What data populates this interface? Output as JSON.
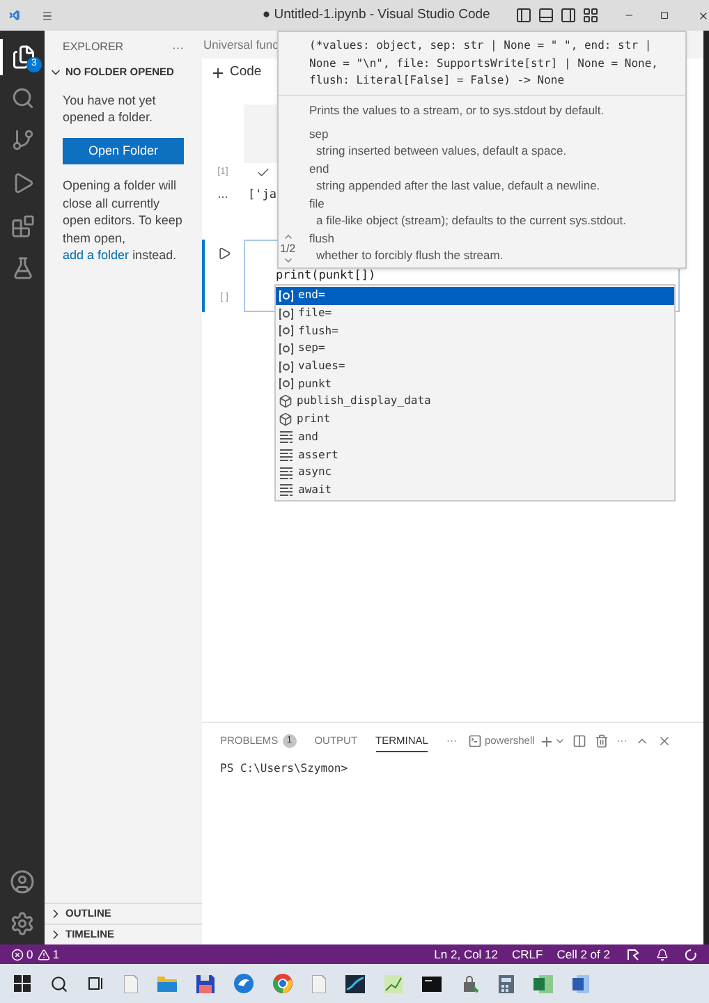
{
  "window": {
    "title": "● Untitled-1.ipynb - Visual Studio Code"
  },
  "activity_bar": {
    "explorer_badge": "3"
  },
  "sidebar": {
    "title": "EXPLORER",
    "more": "···",
    "section": {
      "label": "NO FOLDER OPENED",
      "expanded": true
    },
    "message": "You have not yet opened a folder.",
    "button": "Open Folder",
    "note": "Opening a folder will close all currently open editors. To keep them open,",
    "note_link": "add a folder",
    "note_end": "instead.",
    "bottom_sections": [
      {
        "label": "OUTLINE",
        "expanded": false
      },
      {
        "label": "TIMELINE",
        "expanded": false
      }
    ]
  },
  "editor": {
    "breadcrumb": "Universal func",
    "toolbar": {
      "add_code": "Code"
    },
    "cells": [
      {
        "exec_label": "[1]",
        "done": true,
        "output_dots": "...",
        "output": "['ja",
        "active": false
      },
      {
        "exec_label": "[ ]",
        "active": true,
        "code": "print(punkt[])"
      }
    ]
  },
  "hover": {
    "signature": [
      "(*values: object, sep: str | None = \" \", end: str |",
      "None = \"\\n\", file: SupportsWrite[str] | None = None,",
      "flush: Literal[False] = False) -> None"
    ],
    "description": "Prints the values to a stream, or to sys.stdout by default.",
    "params": [
      {
        "name": "sep",
        "desc": "string inserted between values, default a space."
      },
      {
        "name": "end",
        "desc": "string appended after the last value, default a newline."
      },
      {
        "name": "file",
        "desc": "a file-like object (stream); defaults to the current sys.stdout."
      },
      {
        "name": "flush",
        "desc": "whether to forcibly flush the stream."
      }
    ],
    "overload": "1/2"
  },
  "suggestions": [
    {
      "label": "end=",
      "kind": "variable",
      "selected": true
    },
    {
      "label": "file=",
      "kind": "variable",
      "selected": false
    },
    {
      "label": "flush=",
      "kind": "variable",
      "selected": false
    },
    {
      "label": "sep=",
      "kind": "variable",
      "selected": false
    },
    {
      "label": "values=",
      "kind": "variable",
      "selected": false
    },
    {
      "label": "punkt",
      "kind": "variable",
      "selected": false
    },
    {
      "label": "publish_display_data",
      "kind": "function",
      "selected": false
    },
    {
      "label": "print",
      "kind": "function",
      "selected": false
    },
    {
      "label": "and",
      "kind": "keyword",
      "selected": false
    },
    {
      "label": "assert",
      "kind": "keyword",
      "selected": false
    },
    {
      "label": "async",
      "kind": "keyword",
      "selected": false
    },
    {
      "label": "await",
      "kind": "keyword",
      "selected": false
    }
  ],
  "panel": {
    "tabs": [
      {
        "label": "PROBLEMS",
        "badge": "1",
        "selected": false
      },
      {
        "label": "OUTPUT",
        "selected": false
      },
      {
        "label": "TERMINAL",
        "selected": true
      }
    ],
    "more": "···",
    "terminal_name": "powershell",
    "more2": "···",
    "terminal_line": "PS C:\\Users\\Szymon>"
  },
  "status_bar": {
    "errors": "0",
    "warnings": "1",
    "items": [
      "Ln 2, Col 12",
      "CRLF",
      "Cell 2 of 2"
    ]
  }
}
